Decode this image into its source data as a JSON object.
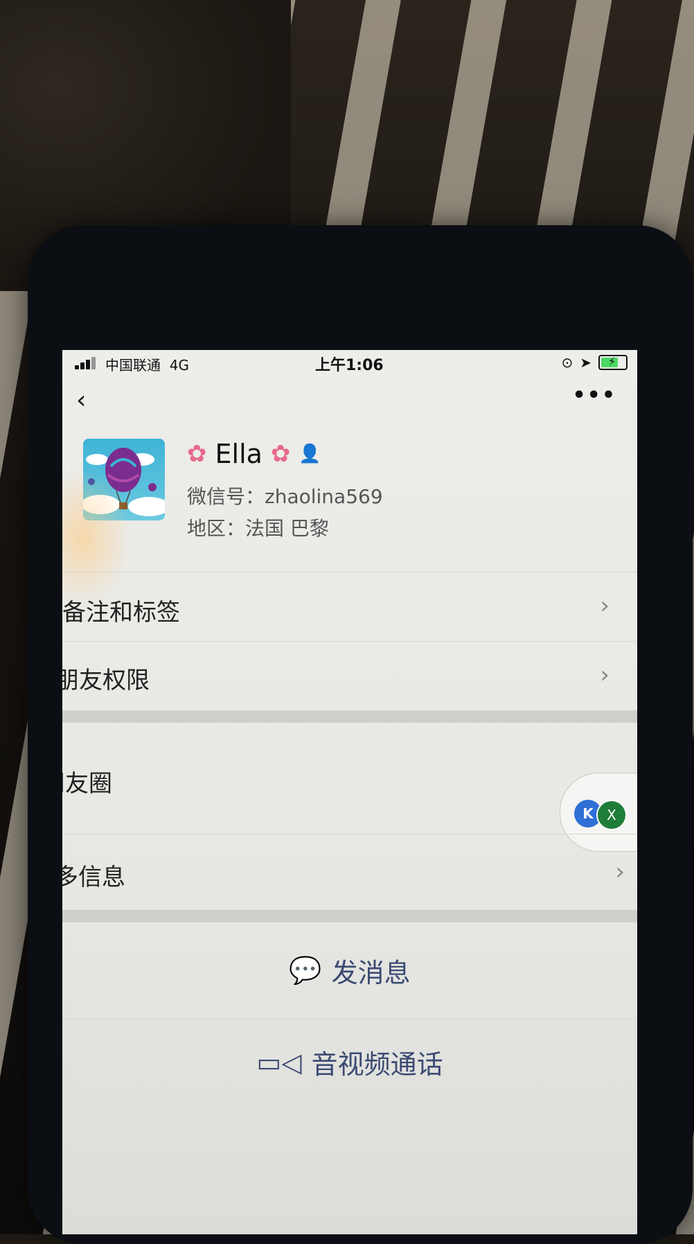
{
  "status_bar": {
    "carrier": "中国联通",
    "network": "4G",
    "time": "上午1:06"
  },
  "profile": {
    "name": "Ella",
    "wechat_id": "微信号：zhaolina569",
    "region": "地区：法国 巴黎"
  },
  "menu": {
    "remarks_tags": "备注和标签",
    "friend_permissions": "朋友权限",
    "moments": "朋友圈",
    "more_info": "更多信息"
  },
  "actions": {
    "send_message": "发消息",
    "video_call": "音视频通话"
  },
  "floating": {
    "badge_a": "K",
    "badge_b": "X"
  },
  "colors": {
    "flower": "#e86a8a",
    "action_text": "#3b4a73",
    "battery": "#4cd964"
  }
}
